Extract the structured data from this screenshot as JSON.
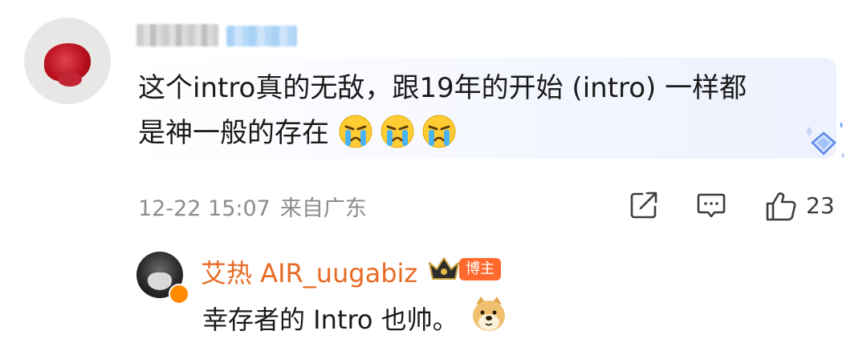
{
  "comment": {
    "text_line1": "这个intro真的无敌，跟19年的开始 (intro) 一样都",
    "text_line2": "是神一般的存在",
    "time": "12-22 15:07",
    "location": "来自广东",
    "like_count": "23",
    "icons": [
      "share-icon",
      "reply-icon",
      "like-icon",
      "crying-emoji"
    ]
  },
  "reply": {
    "author": "艾热 AIR_uugabiz",
    "badge": "博主",
    "text": "幸存者的 Intro 也帅。",
    "icons": [
      "crown-icon",
      "doge-emoji"
    ]
  },
  "colors": {
    "author_orange": "#e86b25",
    "badge_orange": "#ff6a2c",
    "meta_gray": "#8c8c8c"
  }
}
